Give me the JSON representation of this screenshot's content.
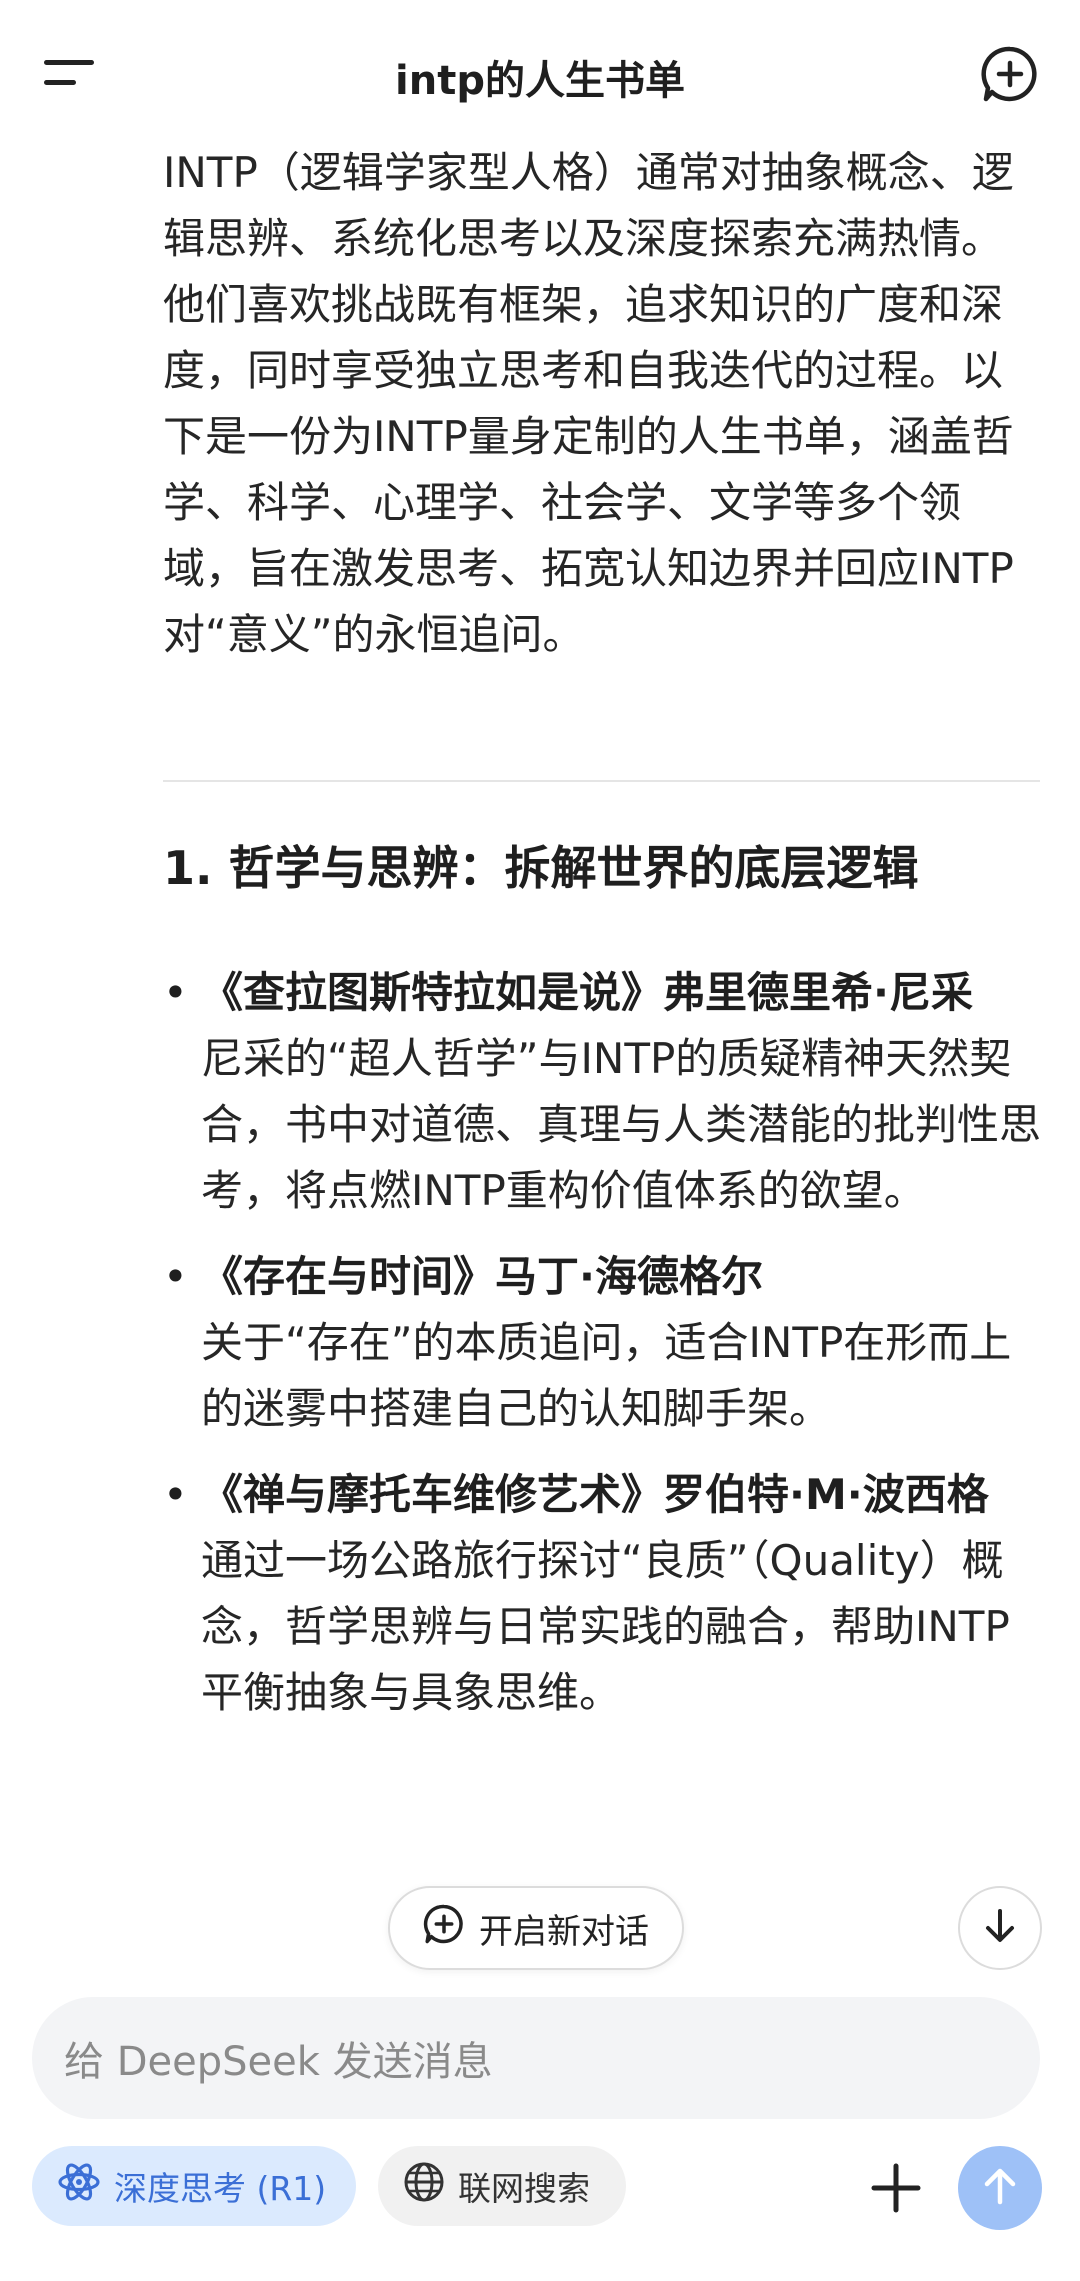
{
  "header": {
    "title": "intp的人生书单"
  },
  "content": {
    "intro": "INTP（逻辑学家型人格）通常对抽象概念、逻辑思辨、系统化思考以及深度探索充满热情。他们喜欢挑战既有框架，追求知识的广度和深度，同时享受独立思考和自我迭代的过程。以下是一份为INTP量身定制的人生书单，涵盖哲学、科学、心理学、社会学、文学等多个领域，旨在激发思考、拓宽认知边界并回应INTP对“意义”的永恒追问。",
    "section_title": "1. 哲学与思辨：拆解世界的底层逻辑",
    "books": [
      {
        "title": "《查拉图斯特拉如是说》弗里德里希·尼采",
        "desc": "尼采的“超人哲学”与INTP的质疑精神天然契合，书中对道德、真理与人类潜能的批判性思考，将点燃INTP重构价值体系的欲望。"
      },
      {
        "title": "《存在与时间》马丁·海德格尔",
        "desc": "关于“存在”的本质追问，适合INTP在形而上的迷雾中搭建自己的认知脚手架。"
      },
      {
        "title": "《禅与摩托车维修艺术》罗伯特·M·波西格",
        "desc": "通过一场公路旅行探讨“良质”（Quality）概念，哲学思辨与日常实践的融合，帮助INTP平衡抽象与具象思维。"
      }
    ],
    "bullet": "•"
  },
  "floating": {
    "new_dialog_label": "开启新对话"
  },
  "composer": {
    "placeholder": "给 DeepSeek 发送消息",
    "deep_think_label": "深度思考 (R1)",
    "web_search_label": "联网搜索"
  },
  "colors": {
    "accent": "#3b6fd6",
    "accent_bg": "#dbeafe",
    "send_button": "#9ec1f7",
    "input_bg": "#f3f4f6"
  }
}
